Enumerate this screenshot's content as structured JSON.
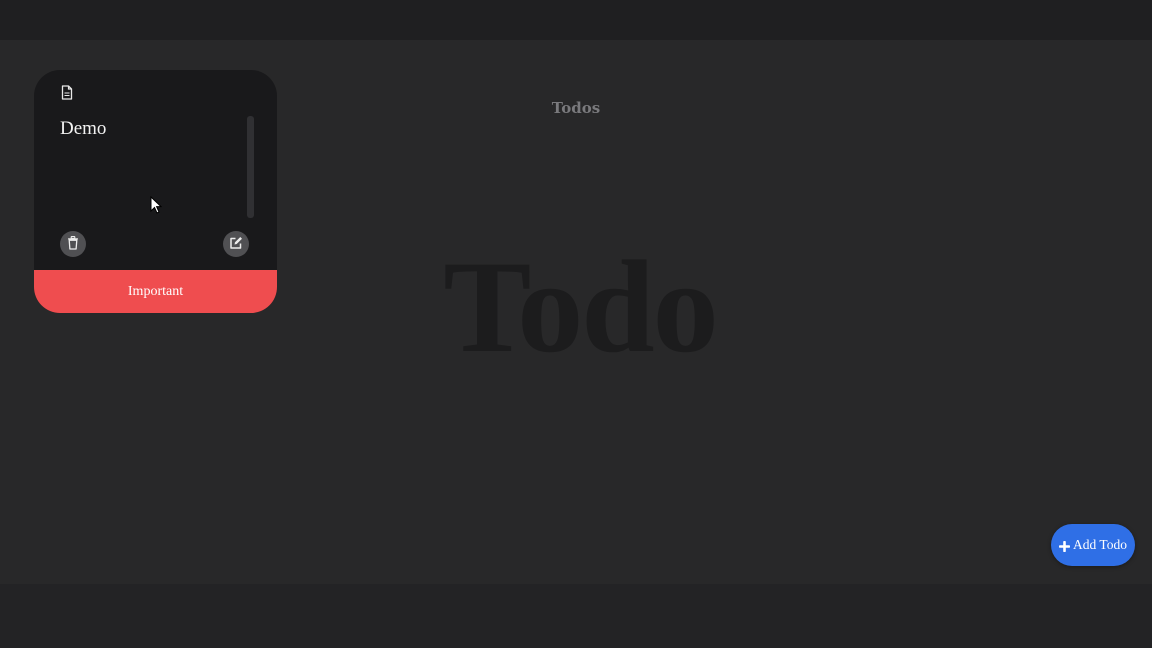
{
  "header": {
    "title": "Todos"
  },
  "background": {
    "watermark": "Todo"
  },
  "todo_card": {
    "icon": "document-icon",
    "title": "Demo",
    "priority_label": "Important",
    "delete_icon": "trash-icon",
    "edit_icon": "edit-icon",
    "priority_color": "#ef4d4f"
  },
  "actions": {
    "add_label": "Add Todo",
    "add_icon": "plus-icon",
    "accent_color": "#2f6fe6"
  }
}
